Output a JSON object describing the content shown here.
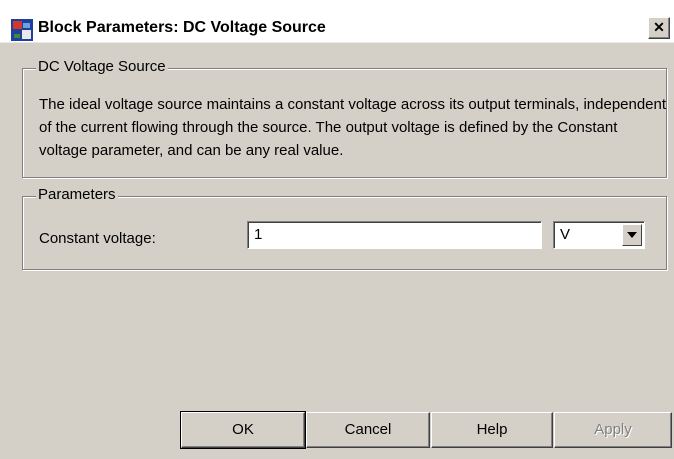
{
  "window": {
    "title": "Block Parameters: DC Voltage Source",
    "close_label": "✕"
  },
  "description_group": {
    "legend": "DC Voltage Source",
    "text": "The ideal voltage source maintains a constant voltage across its output terminals, independent of the current flowing through the source. The output voltage is defined by the Constant voltage parameter, and can be any real value."
  },
  "parameters_group": {
    "legend": "Parameters",
    "constant_voltage": {
      "label": "Constant voltage:",
      "value": "1",
      "unit": "V"
    }
  },
  "buttons": {
    "ok": "OK",
    "cancel": "Cancel",
    "help": "Help",
    "apply": "Apply"
  },
  "colors": {
    "dialog_bg": "#d4d0c8",
    "titlebar_bg": "#ffffff",
    "disabled_text": "#808080"
  }
}
